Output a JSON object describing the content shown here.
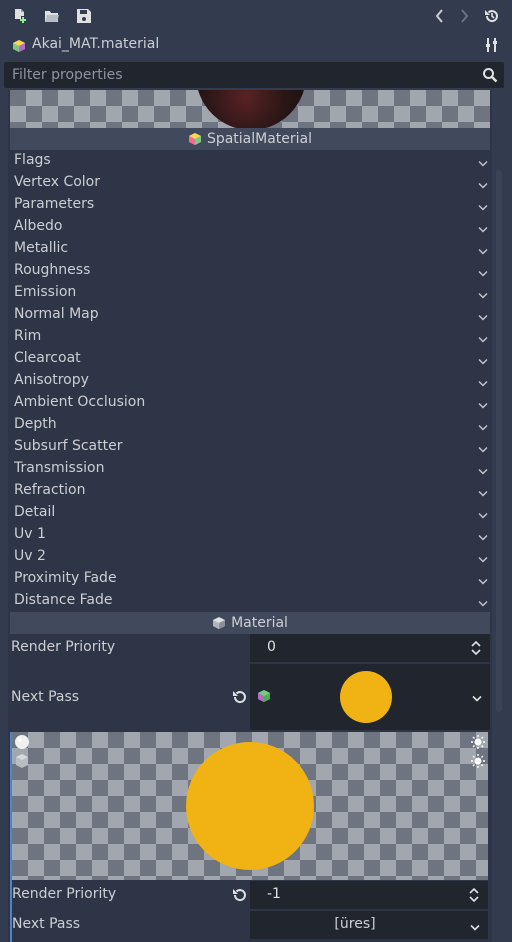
{
  "toolbar": {
    "new_resource": "new-resource-icon",
    "open_resource": "load-icon",
    "save_resource": "save-icon",
    "back": "back-icon",
    "forward": "forward-icon",
    "history": "history-icon"
  },
  "resource": {
    "name": "Akai_MAT.material",
    "icon": "material-cube-icon",
    "tools": "object-tools-icon"
  },
  "filter": {
    "placeholder": "Filter properties",
    "icon": "search-icon"
  },
  "sections": {
    "spatial_material": "SpatialMaterial",
    "material": "Material"
  },
  "categories": [
    "Flags",
    "Vertex Color",
    "Parameters",
    "Albedo",
    "Metallic",
    "Roughness",
    "Emission",
    "Normal Map",
    "Rim",
    "Clearcoat",
    "Anisotropy",
    "Ambient Occlusion",
    "Depth",
    "Subsurf Scatter",
    "Transmission",
    "Refraction",
    "Detail",
    "Uv 1",
    "Uv 2",
    "Proximity Fade",
    "Distance Fade"
  ],
  "material": {
    "render_priority_label": "Render Priority",
    "render_priority_value": "0",
    "next_pass_label": "Next Pass",
    "next_pass_swatch_color": "#f1b314"
  },
  "next_pass_material": {
    "render_priority_label": "Render Priority",
    "render_priority_value": "-1",
    "next_pass_label": "Next Pass",
    "next_pass_value": "[üres]",
    "preview_color": "#f1b314"
  },
  "colors": {
    "background": "#333b4f",
    "panel": "#2e3546",
    "section_header": "#414a5c",
    "field": "#21262e",
    "text": "#ccced3",
    "accent_yellow": "#f1b314",
    "nested_border": "#4a86c8"
  }
}
